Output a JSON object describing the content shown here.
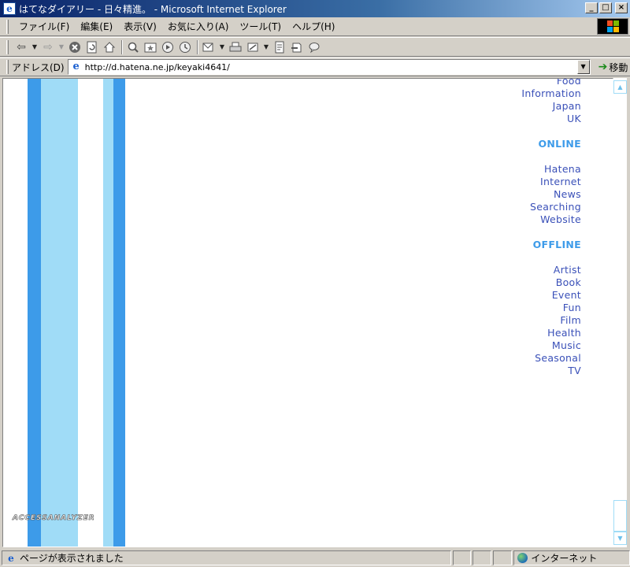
{
  "window": {
    "title": "はてなダイアリー - 日々精進。 - Microsoft Internet Explorer",
    "controls": {
      "minimize": "_",
      "maximize": "□",
      "close": "×"
    }
  },
  "menubar": {
    "items": [
      "ファイル(F)",
      "編集(E)",
      "表示(V)",
      "お気に入り(A)",
      "ツール(T)",
      "ヘルプ(H)"
    ]
  },
  "toolbar": {
    "icons": [
      "back-icon",
      "forward-icon",
      "stop-icon",
      "refresh-icon",
      "home-icon",
      "search-icon",
      "favorites-icon",
      "history-icon",
      "media-icon",
      "mail-icon",
      "print-icon",
      "edit-icon",
      "discuss-icon",
      "messenger-icon"
    ]
  },
  "address": {
    "label": "アドレス(D)",
    "url": "http://d.hatena.ne.jp/keyaki4641/",
    "go_label": "移動"
  },
  "content": {
    "categories_top": [
      "Food",
      "Information",
      "Japan",
      "UK"
    ],
    "online_heading": "ONLINE",
    "online_links": [
      "Hatena",
      "Internet",
      "News",
      "Searching",
      "Website"
    ],
    "offline_heading": "OFFLINE",
    "offline_links": [
      "Artist",
      "Book",
      "Event",
      "Fun",
      "Film",
      "Health",
      "Music",
      "Seasonal",
      "TV"
    ],
    "analyzer_label": "ACCESSANALYZER"
  },
  "status": {
    "text": "ページが表示されました",
    "zone": "インターネット"
  },
  "colors": {
    "stripe_dark": "#3d9be9",
    "stripe_light": "#a0dcf7",
    "link": "#3a50b8",
    "heading": "#3d9be9"
  }
}
